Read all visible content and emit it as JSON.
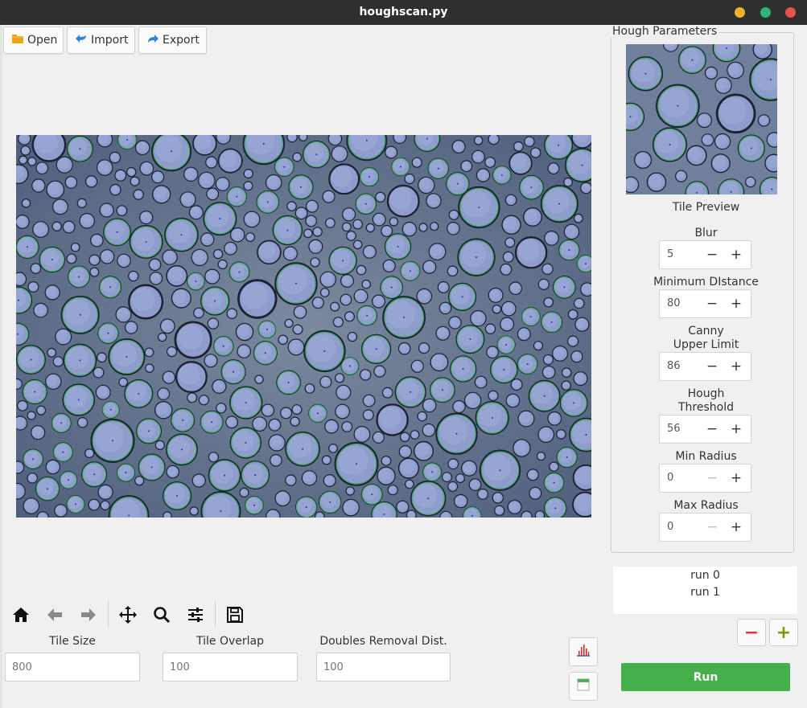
{
  "window": {
    "title": "houghscan.py",
    "controls": {
      "minimize_color": "#f0b429",
      "maximize_color": "#2bb673",
      "close_color": "#e5534b"
    }
  },
  "toolbar": {
    "open_label": "Open",
    "import_label": "Import",
    "export_label": "Export"
  },
  "nav_toolbar": {
    "icons": [
      "home-icon",
      "back-arrow-icon",
      "forward-arrow-icon",
      "pan-move-icon",
      "zoom-magnifier-icon",
      "configure-sliders-icon",
      "save-floppy-icon"
    ]
  },
  "fields": {
    "tile_size": {
      "label": "Tile Size",
      "placeholder": "800"
    },
    "tile_overlap": {
      "label": "Tile Overlap",
      "placeholder": "100"
    },
    "doubles_removal": {
      "label": "Doubles Removal Dist.",
      "placeholder": "100"
    }
  },
  "side_buttons": [
    "histogram-icon",
    "window-icon"
  ],
  "hough": {
    "group_title": "Hough Parameters",
    "preview_caption": "Tile Preview",
    "params": [
      {
        "label_lines": [
          "Blur"
        ],
        "value": "5"
      },
      {
        "label_lines": [
          "Minimum DIstance"
        ],
        "value": "80"
      },
      {
        "label_lines": [
          "Canny",
          "Upper Limit"
        ],
        "value": "86"
      },
      {
        "label_lines": [
          "Hough",
          "Threshold"
        ],
        "value": "56"
      },
      {
        "label_lines": [
          "Min Radius"
        ],
        "value": "0"
      },
      {
        "label_lines": [
          "Max Radius"
        ],
        "value": "0"
      }
    ],
    "minus_glyph": "−",
    "plus_glyph": "+"
  },
  "runs": {
    "items": [
      "run 0",
      "run 1"
    ]
  },
  "run_controls": {
    "remove_glyph": "−",
    "add_glyph": "+",
    "run_label": "Run"
  },
  "colors": {
    "accent_green": "#45b04b",
    "remove_red": "#d9383a",
    "add_green": "#7a9b10",
    "circle_green": "#3cb25a",
    "bubble_fill": "#8e9dcb"
  }
}
